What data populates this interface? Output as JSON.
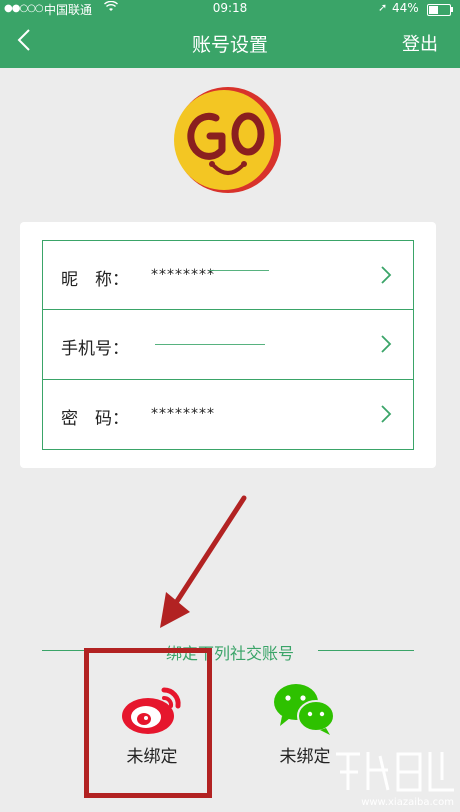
{
  "status_bar": {
    "signal": "●●○○○",
    "carrier": "中国联通",
    "wifi": "wifi-icon",
    "time": "09:18",
    "location": "location-arrow-icon",
    "battery": "44%",
    "battery_level": 0.44
  },
  "nav": {
    "back_icon": "chevron-left-icon",
    "title": "账号设置",
    "logout": "登出"
  },
  "avatar": {
    "logo_text": "GO"
  },
  "account_rows": [
    {
      "label": "昵　称：",
      "value": "********"
    },
    {
      "label": "手机号：",
      "value": ""
    },
    {
      "label": "密　码：",
      "value": "********"
    }
  ],
  "social": {
    "heading": "绑定下列社交账号",
    "accounts": [
      {
        "icon": "weibo-icon",
        "status": "未绑定"
      },
      {
        "icon": "wechat-icon",
        "status": "未绑定"
      }
    ]
  },
  "watermark": {
    "url": "www.xiazaiba.com"
  },
  "colors": {
    "brand_green": "#3aa468",
    "annotation_red": "#b22222",
    "weibo_red": "#e6162d",
    "wechat_green": "#2ec100"
  }
}
